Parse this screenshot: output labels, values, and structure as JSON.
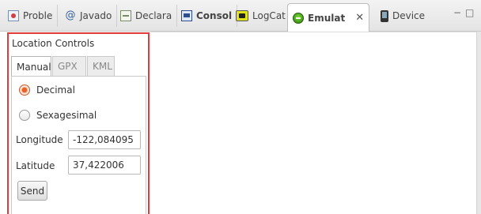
{
  "tabs": [
    {
      "label": "Proble",
      "icon": "problems-icon"
    },
    {
      "label": "Javado",
      "icon": "javadoc-icon"
    },
    {
      "label": "Declara",
      "icon": "declaration-icon"
    },
    {
      "label": "Consol",
      "icon": "console-icon"
    },
    {
      "label": "LogCat",
      "icon": "logcat-icon"
    },
    {
      "label": "Emulat",
      "icon": "emulator-icon",
      "active": true
    },
    {
      "label": "Device",
      "icon": "device-icon"
    }
  ],
  "close_glyph": "✕",
  "window_controls": {
    "minimize": "−",
    "maximize": "□"
  },
  "location_controls": {
    "title": "Location Controls",
    "subtabs": [
      "Manual",
      "GPX",
      "KML"
    ],
    "active_subtab": "Manual",
    "format_options": [
      {
        "label": "Decimal",
        "checked": true
      },
      {
        "label": "Sexagesimal",
        "checked": false
      }
    ],
    "longitude": {
      "label": "Longitude",
      "value": "-122,084095"
    },
    "latitude": {
      "label": "Latitude",
      "value": "37,422006"
    },
    "send_label": "Send"
  },
  "colors": {
    "highlight": "#e23b3b",
    "radio_selected": "#e8632a"
  }
}
